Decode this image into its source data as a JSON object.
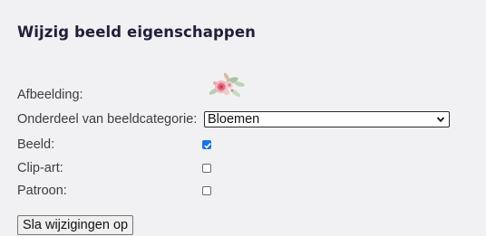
{
  "page": {
    "title": "Wijzig beeld eigenschappen"
  },
  "form": {
    "image_label": "Afbeelding:",
    "category_label": "Onderdeel van beeldcategorie:",
    "category_selected": "Bloemen",
    "image_flag_label": "Beeld:",
    "image_flag_checked": true,
    "clipart_label": "Clip-art:",
    "clipart_checked": false,
    "pattern_label": "Patroon:",
    "pattern_checked": false,
    "save_label": "Sla wijzigingen op"
  },
  "colors": {
    "checkbox_checked": "#1a73e8",
    "title": "#20203a"
  },
  "icons": {
    "select_arrow": "chevron-down-icon",
    "check": "checkmark-icon",
    "thumbnail": "flower-bouquet-thumbnail"
  }
}
